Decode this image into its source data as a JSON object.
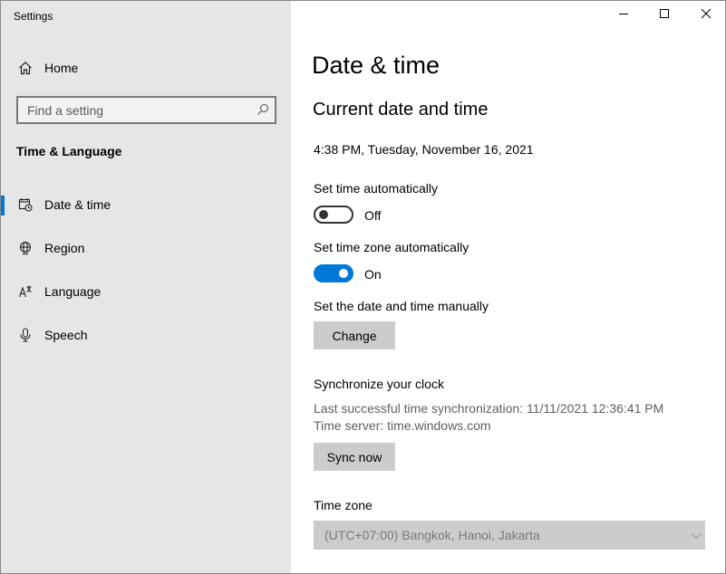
{
  "window": {
    "title": "Settings"
  },
  "title_bar": {
    "minimize_icon": "minimize-icon",
    "maximize_icon": "maximize-icon",
    "close_icon": "close-icon"
  },
  "sidebar": {
    "home": {
      "label": "Home",
      "icon": "home-icon"
    },
    "search": {
      "placeholder": "Find a setting",
      "value": "",
      "icon": "search-icon"
    },
    "section_title": "Time & Language",
    "items": [
      {
        "label": "Date & time",
        "icon": "date-time-icon",
        "selected": true
      },
      {
        "label": "Region",
        "icon": "region-icon",
        "selected": false
      },
      {
        "label": "Language",
        "icon": "language-icon",
        "selected": false
      },
      {
        "label": "Speech",
        "icon": "microphone-icon",
        "selected": false
      }
    ],
    "accent_color": "#0078d7",
    "background_color": "#e6e6e6"
  },
  "main": {
    "page_title": "Date & time",
    "section_title": "Current date and time",
    "current_datetime": "4:38 PM, Tuesday, November 16, 2021",
    "set_time_auto": {
      "label": "Set time automatically",
      "state_label": "Off",
      "on": false
    },
    "set_timezone_auto": {
      "label": "Set time zone automatically",
      "state_label": "On",
      "on": true
    },
    "manual": {
      "label": "Set the date and time manually",
      "button": "Change"
    },
    "sync": {
      "title": "Synchronize your clock",
      "last_sync": "Last successful time synchronization: 11/11/2021 12:36:41 PM",
      "server": "Time server: time.windows.com",
      "button": "Sync now"
    },
    "timezone": {
      "label": "Time zone",
      "value": "(UTC+07:00) Bangkok, Hanoi, Jakarta",
      "disabled": true
    }
  }
}
